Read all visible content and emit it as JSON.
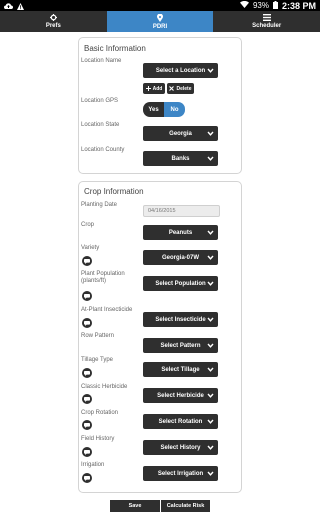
{
  "status_bar": {
    "battery": "93%",
    "time": "2:38 PM",
    "icons": [
      "cloud-upload-icon",
      "alert-icon",
      "wifi-icon",
      "battery-icon"
    ]
  },
  "tabs": [
    {
      "label": "Prefs",
      "icon": "gear-icon",
      "active": false
    },
    {
      "label": "PDRI",
      "icon": "location-pin-icon",
      "active": true
    },
    {
      "label": "Scheduler",
      "icon": "list-icon",
      "active": false
    }
  ],
  "basic": {
    "title": "Basic Information",
    "location_name_label": "Location Name",
    "location_select": "Select a Location",
    "add_label": "Add",
    "delete_label": "Delete",
    "gps_label": "Location GPS",
    "gps_yes": "Yes",
    "gps_no": "No",
    "state_label": "Location State",
    "state_value": "Georgia",
    "county_label": "Location County",
    "county_value": "Banks"
  },
  "crop": {
    "title": "Crop Information",
    "planting_date_label": "Planting Date",
    "planting_date_value": "04/16/2015",
    "crop_label": "Crop",
    "crop_value": "Peanuts",
    "variety_label": "Variety",
    "variety_value": "Georgia-07W",
    "plant_population_label": "Plant Population (plants/ft)",
    "plant_population_value": "Select Population",
    "insecticide_label": "At-Plant Insecticide",
    "insecticide_value": "Select Insecticide",
    "row_pattern_label": "Row Pattern",
    "row_pattern_value": "Select Pattern",
    "tillage_label": "Tillage Type",
    "tillage_value": "Select Tillage",
    "herbicide_label": "Classic Herbicide",
    "herbicide_value": "Select Herbicide",
    "rotation_label": "Crop Rotation",
    "rotation_value": "Select Rotation",
    "history_label": "Field History",
    "history_value": "Select History",
    "irrigation_label": "Irrigation",
    "irrigation_value": "Select Irrigation"
  },
  "footer": {
    "save_label": "Save",
    "calculate_label": "Calculate Risk"
  },
  "colors": {
    "accent": "#3d86c6",
    "dark": "#2f2f2f"
  }
}
